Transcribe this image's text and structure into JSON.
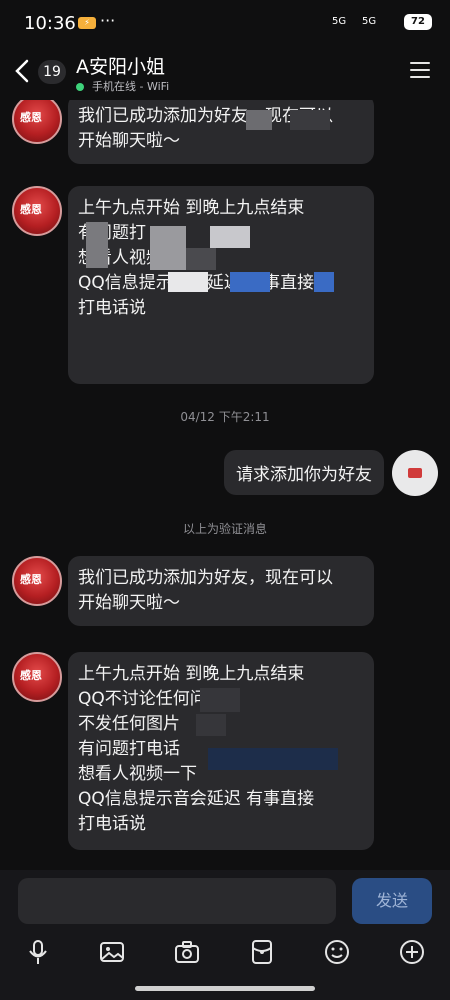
{
  "status": {
    "time": "10:36",
    "app_badge": "⚡",
    "more": "···",
    "signal_a": "5G",
    "signal_b": "5G",
    "battery": "72"
  },
  "header": {
    "unread": "19",
    "title": "A安阳小姐",
    "presence": "手机在线 - WiFi"
  },
  "messages": {
    "m1": {
      "lines": [
        "我们已成功添加为好友，现在可以",
        "开始聊天啦～"
      ]
    },
    "m2": {
      "lines": [
        "上午九点开始  到晚上九点结束",
        "",
        "",
        "有问题打",
        "想看人视频",
        "QQ信息提示音会延迟  有事直接",
        "打电话说"
      ]
    },
    "timestamp": "04/12 下午2:11",
    "self": "请求添加你为好友",
    "verify_notice": "以上为验证消息",
    "m3": {
      "lines": [
        "我们已成功添加为好友，现在可以",
        "开始聊天啦～"
      ]
    },
    "m4": {
      "lines": [
        "上午九点开始  到晚上九点结束",
        "QQ不讨论任何问",
        "不发任何图片",
        "有问题打电话",
        "想看人视频一下",
        "QQ信息提示音会延迟  有事直接",
        "打电话说"
      ]
    }
  },
  "input": {
    "send_label": "发送"
  },
  "toolbar": [
    "microphone-icon",
    "image-icon",
    "camera-icon",
    "red-packet-icon",
    "emoji-icon",
    "plus-icon"
  ]
}
